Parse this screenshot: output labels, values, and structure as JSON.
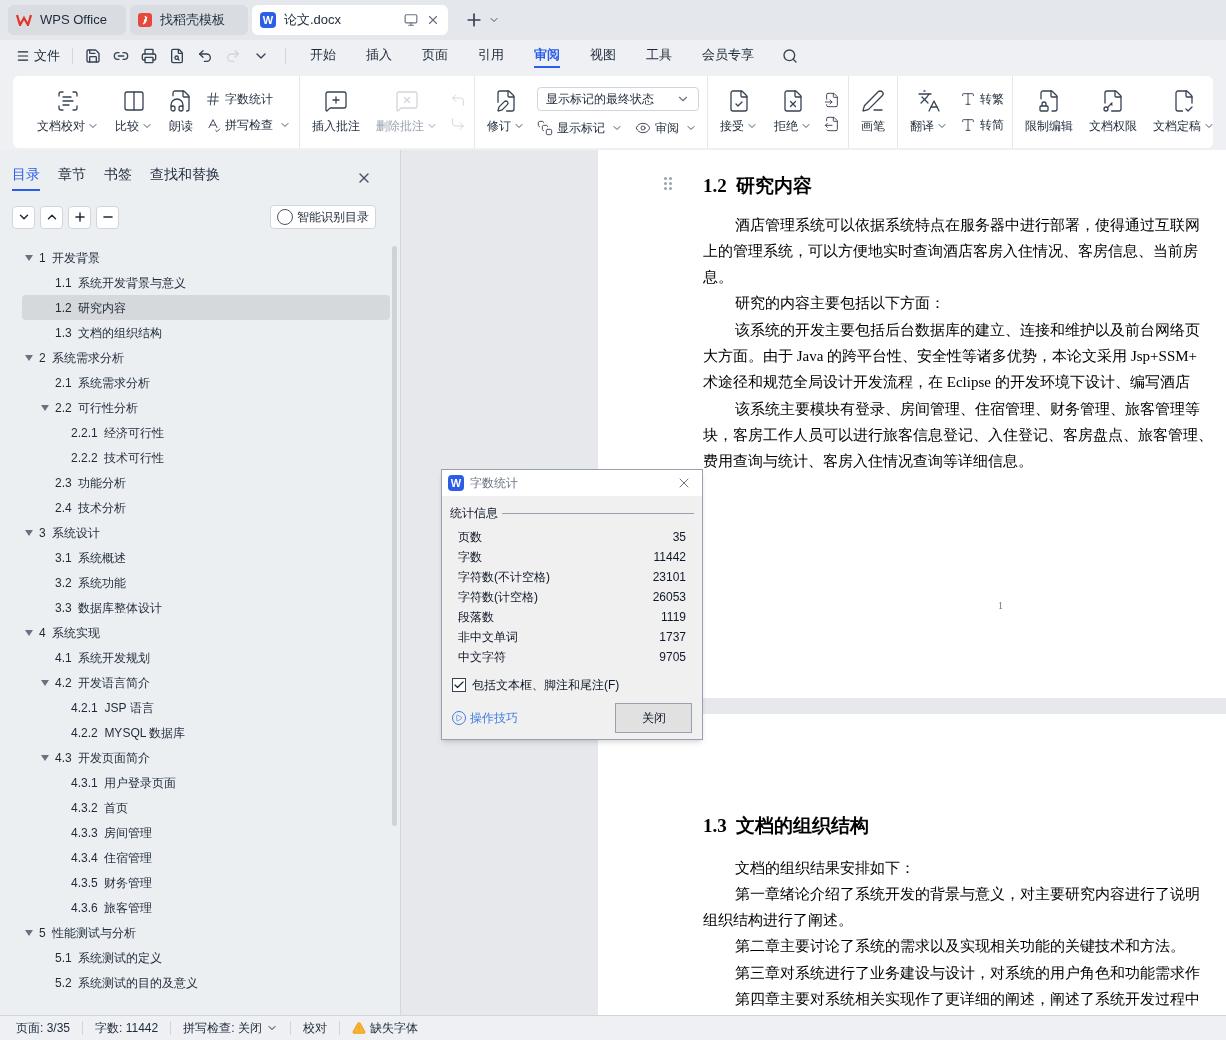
{
  "app_tabs": [
    {
      "kind": "wps",
      "label": "WPS Office",
      "selected": false
    },
    {
      "kind": "docer",
      "label": "找稻壳模板",
      "selected": false
    },
    {
      "kind": "doc",
      "badge": "W",
      "label": "论文.docx",
      "selected": true
    }
  ],
  "menu": {
    "file": "文件",
    "tabs": [
      {
        "label": "开始",
        "selected": false
      },
      {
        "label": "插入",
        "selected": false
      },
      {
        "label": "页面",
        "selected": false
      },
      {
        "label": "引用",
        "selected": false
      },
      {
        "label": "审阅",
        "selected": true
      },
      {
        "label": "视图",
        "selected": false
      },
      {
        "label": "工具",
        "selected": false
      },
      {
        "label": "会员专享",
        "selected": false
      }
    ]
  },
  "ribbon": [
    [
      {
        "kind": "large",
        "label": "文档校对",
        "dropdown": true,
        "disabled": false
      },
      {
        "kind": "large",
        "label": "比较",
        "dropdown": true,
        "disabled": false
      },
      {
        "kind": "large",
        "label": "朗读",
        "dropdown": false,
        "disabled": false
      },
      {
        "kind": "stack",
        "items": [
          {
            "label": "字数统计",
            "dropdown": false,
            "disabled": false
          },
          {
            "label": "拼写检查",
            "dropdown": true,
            "disabled": false
          }
        ]
      }
    ],
    [
      {
        "kind": "large",
        "label": "插入批注",
        "dropdown": false,
        "disabled": false
      },
      {
        "kind": "large",
        "label": "删除批注",
        "dropdown": true,
        "disabled": true
      },
      {
        "kind": "stack",
        "items": [
          {
            "dropdown": false,
            "disabled": true
          },
          {
            "dropdown": false,
            "disabled": true
          }
        ]
      }
    ],
    [
      {
        "kind": "large",
        "label": "修订",
        "dropdown": true,
        "disabled": false
      },
      {
        "kind": "select",
        "value": "显示标记的最终状态",
        "items": [
          {
            "label": "显示标记",
            "dropdown": true,
            "disabled": false
          },
          {
            "label": "审阅",
            "dropdown": true,
            "disabled": false
          }
        ]
      }
    ],
    [
      {
        "kind": "large",
        "label": "接受",
        "dropdown": true,
        "disabled": false
      },
      {
        "kind": "large",
        "label": "拒绝",
        "dropdown": true,
        "disabled": false
      },
      {
        "kind": "stack",
        "items": [
          {
            "dropdown": false,
            "disabled": false
          },
          {
            "dropdown": false,
            "disabled": false
          }
        ]
      }
    ],
    [
      {
        "kind": "large",
        "label": "画笔",
        "dropdown": false,
        "disabled": false
      }
    ],
    [
      {
        "kind": "large",
        "label": "翻译",
        "dropdown": true,
        "disabled": false
      },
      {
        "kind": "stack",
        "items": [
          {
            "label": "转繁",
            "dropdown": false,
            "disabled": false
          },
          {
            "label": "转简",
            "dropdown": false,
            "disabled": false
          }
        ]
      }
    ],
    [
      {
        "kind": "large",
        "label": "限制编辑",
        "dropdown": false,
        "disabled": false
      },
      {
        "kind": "large",
        "label": "文档权限",
        "dropdown": false,
        "disabled": false
      },
      {
        "kind": "large",
        "label": "文档定稿",
        "dropdown": true,
        "disabled": false
      }
    ]
  ],
  "nav_panel": {
    "tabs": [
      {
        "label": "目录",
        "selected": true
      },
      {
        "label": "章节",
        "selected": false
      },
      {
        "label": "书签",
        "selected": false
      },
      {
        "label": "查找和替换",
        "selected": false
      }
    ],
    "smart_button": "智能识别目录",
    "toc": [
      {
        "num": "1",
        "title": "开发背景",
        "selected": false,
        "expanded": true,
        "children": [
          {
            "num": "1.1",
            "title": "系统开发背景与意义",
            "selected": false
          },
          {
            "num": "1.2",
            "title": "研究内容",
            "selected": true
          },
          {
            "num": "1.3",
            "title": "文档的组织结构",
            "selected": false
          }
        ]
      },
      {
        "num": "2",
        "title": "系统需求分析",
        "selected": false,
        "expanded": true,
        "children": [
          {
            "num": "2.1",
            "title": "系统需求分析",
            "selected": false
          },
          {
            "num": "2.2",
            "title": "可行性分析",
            "selected": false,
            "expanded": true,
            "children": [
              {
                "num": "2.2.1",
                "title": "经济可行性",
                "selected": false
              },
              {
                "num": "2.2.2",
                "title": "技术可行性",
                "selected": false
              }
            ]
          },
          {
            "num": "2.3",
            "title": "功能分析",
            "selected": false
          },
          {
            "num": "2.4",
            "title": "技术分析",
            "selected": false
          }
        ]
      },
      {
        "num": "3",
        "title": "系统设计",
        "selected": false,
        "expanded": true,
        "children": [
          {
            "num": "3.1",
            "title": "系统概述",
            "selected": false
          },
          {
            "num": "3.2",
            "title": "系统功能",
            "selected": false
          },
          {
            "num": "3.3",
            "title": "数据库整体设计",
            "selected": false
          }
        ]
      },
      {
        "num": "4",
        "title": "系统实现",
        "selected": false,
        "expanded": true,
        "children": [
          {
            "num": "4.1",
            "title": "系统开发规划",
            "selected": false
          },
          {
            "num": "4.2",
            "title": "开发语言简介",
            "selected": false,
            "expanded": true,
            "children": [
              {
                "num": "4.2.1",
                "title": "JSP 语言",
                "selected": false
              },
              {
                "num": "4.2.2",
                "title": "MYSQL 数据库",
                "selected": false
              }
            ]
          },
          {
            "num": "4.3",
            "title": "开发页面简介",
            "selected": false,
            "expanded": true,
            "children": [
              {
                "num": "4.3.1",
                "title": "用户登录页面",
                "selected": false
              },
              {
                "num": "4.3.2",
                "title": "首页",
                "selected": false
              },
              {
                "num": "4.3.3",
                "title": "房间管理",
                "selected": false
              },
              {
                "num": "4.3.4",
                "title": "住宿管理",
                "selected": false
              },
              {
                "num": "4.3.5",
                "title": "财务管理",
                "selected": false
              },
              {
                "num": "4.3.6",
                "title": "旅客管理",
                "selected": false
              }
            ]
          }
        ]
      },
      {
        "num": "5",
        "title": "性能测试与分析",
        "selected": false,
        "expanded": true,
        "children": [
          {
            "num": "5.1",
            "title": "系统测试的定义",
            "selected": false
          },
          {
            "num": "5.2",
            "title": "系统测试的目的及意义",
            "selected": false
          }
        ]
      }
    ]
  },
  "pages": [
    {
      "heading_num": "1.2",
      "heading": "研究内容",
      "page_number": "1",
      "paragraphs": [
        {
          "lines": [
            "酒店管理系统可以依据系统特点在服务器中进行部署，使得通过互联网",
            "上的管理系统，可以方便地实时查询酒店客房入住情况、客房信息、当前房",
            "息。"
          ]
        },
        {
          "lines": [
            "研究的内容主要包括以下方面："
          ]
        },
        {
          "lines": [
            "该系统的开发主要包括后台数据库的建立、连接和维护以及前台网络页",
            "大方面。由于 Java 的跨平台性、安全性等诸多优势，本论文采用 Jsp+SSM+",
            "术途径和规范全局设计开发流程，在 Eclipse 的开发环境下设计、编写酒店"
          ]
        },
        {
          "lines": [
            "该系统主要模块有登录、房间管理、住宿管理、财务管理、旅客管理等",
            "块，客房工作人员可以进行旅客信息登记、入住登记、客房盘点、旅客管理、",
            "费用查询与统计、客房入住情况查询等详细信息。"
          ]
        }
      ]
    },
    {
      "heading_num": "1.3",
      "heading": "文档的组织结构",
      "paragraphs": [
        {
          "lines": [
            "文档的组织结果安排如下："
          ]
        },
        {
          "lines": [
            "第一章绪论介绍了系统开发的背景与意义，对主要研究内容进行了说明",
            "组织结构进行了阐述。"
          ]
        },
        {
          "lines": [
            "第二章主要讨论了系统的需求以及实现相关功能的关键技术和方法。"
          ]
        },
        {
          "lines": [
            "第三章对系统进行了业务建设与设计，对系统的用户角色和功能需求作"
          ]
        },
        {
          "lines": [
            "第四章主要对系统相关实现作了更详细的阐述，阐述了系统开发过程中"
          ]
        }
      ]
    }
  ],
  "dialog": {
    "badge": "W",
    "title": "字数统计",
    "group": "统计信息",
    "stats": [
      {
        "label": "页数",
        "value": "35"
      },
      {
        "label": "字数",
        "value": "11442"
      },
      {
        "label": "字符数(不计空格)",
        "value": "23101"
      },
      {
        "label": "字符数(计空格)",
        "value": "26053"
      },
      {
        "label": "段落数",
        "value": "1119"
      },
      {
        "label": "非中文单词",
        "value": "1737"
      },
      {
        "label": "中文字符",
        "value": "9705"
      }
    ],
    "checkbox": {
      "label": "包括文本框、脚注和尾注(F)",
      "checked": true
    },
    "tips": "操作技巧",
    "close_button": "关闭"
  },
  "status_bar": [
    {
      "kind": "text",
      "label": "页面: 3/35"
    },
    {
      "kind": "text",
      "label": "字数: 11442"
    },
    {
      "kind": "dropdown",
      "label": "拼写检查: 关闭"
    },
    {
      "kind": "text",
      "label": "校对"
    },
    {
      "kind": "warning",
      "label": "缺失字体"
    }
  ]
}
